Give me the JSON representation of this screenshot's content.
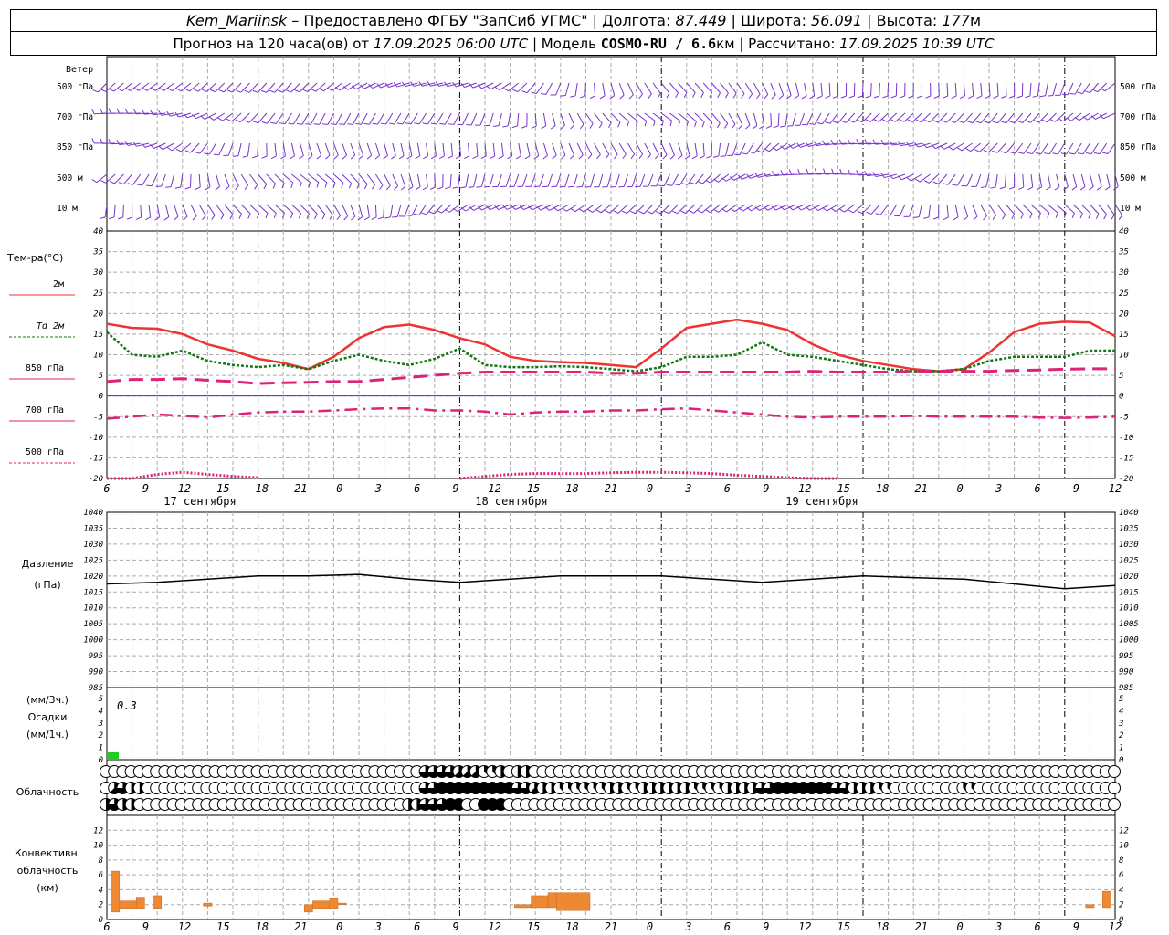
{
  "header": {
    "station": "Kem_Mariinsk",
    "dash": " – Предоставлено ФГБУ \"ЗапСиб УГМС\" | Долгота: ",
    "lon": "87.449",
    "lat_label": " | Широта: ",
    "lat": "56.091",
    "alt_label": " | Высота: ",
    "alt": "177",
    "alt_unit": "м",
    "forecast_label": "Прогноз на 120 часа(ов) от ",
    "forecast_from": "17.09.2025 06:00 UTC",
    "model_label": " | Модель ",
    "model": "COSMO-RU / 6.6",
    "model_unit": "км",
    "computed_label": " | Рассчитано: ",
    "computed": "17.09.2025 10:39 UTC"
  },
  "labels": {
    "wind_title": "Ветер",
    "wind_levels": [
      "500 гПа",
      "700 гПа",
      "850 гПа",
      "500 м",
      "10  м"
    ],
    "temp_title": "Тем-ра(°С)",
    "temp_legend": [
      "2м",
      "Td  2м",
      "850 гПа",
      "700 гПа",
      "500 гПа"
    ],
    "pressure_title": "Давление",
    "pressure_unit": "(гПа)",
    "precip_unit_top": "(мм/3ч.)",
    "precip_title": "Осадки",
    "precip_unit_bottom": "(мм/1ч.)",
    "precip_value_label": "0.3",
    "cloud_title": "Облачность",
    "conv_title": [
      "Конвективн.",
      "облачность",
      "(км)"
    ]
  },
  "colors": {
    "wind": "#7733cc",
    "t2m": "#ee3333",
    "td2m": "#117711",
    "t850": "#dd2277",
    "t700": "#dd2277",
    "t500": "#dd2277",
    "zero_line": "#3333cc",
    "pressure": "#000000",
    "precip": "#22cc22",
    "convective": "#ee8833",
    "grid": "#aaaaaa"
  },
  "chart_data": [
    {
      "type": "line",
      "title": "Тем-ра(°С)",
      "x_hours_from_start": [
        0,
        3,
        6,
        9,
        12,
        15,
        18,
        21,
        24,
        27,
        30,
        33,
        36,
        39,
        42,
        45,
        48,
        51,
        54,
        57,
        60,
        63,
        66,
        69,
        72,
        75,
        78,
        81,
        84,
        87,
        90,
        93,
        96,
        99,
        102,
        105,
        108,
        111,
        114,
        117,
        120
      ],
      "x_tick_labels": [
        "6",
        "9",
        "12",
        "15",
        "18",
        "21",
        "0",
        "3",
        "6",
        "9",
        "12",
        "15",
        "18",
        "21",
        "0",
        "3",
        "6",
        "9",
        "12",
        "15",
        "18",
        "21",
        "0",
        "3",
        "6",
        "9",
        "12"
      ],
      "date_labels": [
        "17 сентября",
        "18 сентября",
        "19 сентября"
      ],
      "ylim": [
        -20,
        40
      ],
      "yticks": [
        40,
        35,
        30,
        25,
        20,
        15,
        10,
        5,
        0,
        -5,
        -10,
        -15,
        -20
      ],
      "series": [
        {
          "name": "2м",
          "values": [
            17.5,
            16.5,
            16.3,
            15.0,
            12.5,
            11.0,
            9.0,
            8.0,
            6.5,
            9.5,
            14.0,
            16.7,
            17.3,
            16.0,
            14.0,
            12.5,
            9.5,
            8.5,
            8.2,
            8.0,
            7.5,
            7.0,
            11.5,
            16.5,
            17.5,
            18.5,
            17.5,
            16.0,
            12.5,
            10.0,
            8.5,
            7.5,
            6.5,
            6.0,
            6.5,
            10.5,
            15.5,
            17.5,
            18.0,
            17.8,
            14.5
          ]
        },
        {
          "name": "Td  2м",
          "values": [
            15.5,
            10.0,
            9.5,
            11.0,
            8.5,
            7.5,
            7.0,
            7.5,
            6.5,
            8.5,
            10.0,
            8.5,
            7.5,
            9.0,
            11.5,
            7.5,
            7.0,
            7.0,
            7.2,
            7.0,
            6.5,
            6.0,
            7.0,
            9.5,
            9.5,
            10.0,
            13.0,
            10.0,
            9.5,
            8.5,
            7.5,
            6.5,
            6.0,
            6.0,
            6.5,
            8.5,
            9.5,
            9.5,
            9.5,
            11.0,
            11.0
          ]
        },
        {
          "name": "850 гПа",
          "values": [
            3.5,
            4.0,
            4.0,
            4.2,
            3.8,
            3.5,
            3.0,
            3.2,
            3.3,
            3.5,
            3.5,
            4.0,
            4.5,
            5.0,
            5.5,
            5.8,
            5.8,
            5.8,
            5.8,
            5.8,
            5.5,
            5.5,
            5.8,
            5.8,
            5.8,
            5.8,
            5.8,
            5.8,
            6.0,
            5.8,
            5.8,
            5.8,
            6.0,
            6.0,
            6.0,
            6.0,
            6.2,
            6.3,
            6.5,
            6.6,
            6.6
          ]
        },
        {
          "name": "700 гПа",
          "values": [
            -5.5,
            -5.0,
            -4.5,
            -4.8,
            -5.2,
            -4.5,
            -4.0,
            -3.8,
            -3.8,
            -3.5,
            -3.2,
            -3.0,
            -3.0,
            -3.5,
            -3.5,
            -3.8,
            -4.5,
            -4.0,
            -3.8,
            -3.8,
            -3.5,
            -3.5,
            -3.2,
            -3.0,
            -3.5,
            -4.0,
            -4.5,
            -5.0,
            -5.2,
            -5.0,
            -5.0,
            -5.0,
            -4.8,
            -5.0,
            -5.0,
            -5.0,
            -5.0,
            -5.2,
            -5.3,
            -5.2,
            -5.0
          ]
        },
        {
          "name": "500 гПа",
          "values": [
            -22,
            -21,
            -19,
            -18.5,
            -19,
            -19.5,
            -19.8,
            null,
            null,
            null,
            null,
            null,
            null,
            null,
            -20,
            -19.5,
            -19,
            -18.8,
            -18.8,
            -18.8,
            -18.6,
            -18.5,
            -18.5,
            -18.6,
            -18.8,
            -19.2,
            -19.5,
            -19.8,
            -20,
            -20,
            null,
            null,
            null,
            null,
            null,
            null,
            null,
            null,
            null,
            null,
            null
          ]
        }
      ]
    },
    {
      "type": "line",
      "title": "Давление",
      "ylabel": "(гПа)",
      "ylim": [
        985,
        1040
      ],
      "yticks": [
        1040,
        1035,
        1030,
        1025,
        1020,
        1015,
        1010,
        1005,
        1000,
        995,
        990,
        985
      ],
      "x_hours_from_start": [
        0,
        6,
        12,
        18,
        24,
        30,
        36,
        42,
        48,
        54,
        60,
        66,
        72,
        78,
        84,
        90,
        96,
        102,
        108,
        114,
        120
      ],
      "series": [
        {
          "name": "",
          "values": [
            1017.5,
            1018,
            1019,
            1020,
            1020,
            1020.5,
            1019,
            1018,
            1019,
            1020,
            1020,
            1020,
            1019,
            1018,
            1019,
            1020,
            1019.5,
            1019,
            1017.5,
            1016,
            1017
          ]
        }
      ]
    },
    {
      "type": "bar",
      "title": "Осадки",
      "ylim": [
        0,
        5
      ],
      "yticks": [
        5,
        4,
        3,
        2,
        1,
        0
      ],
      "x_hours_from_start": [
        0
      ],
      "values": [
        0.3
      ],
      "annotation": "0.3"
    },
    {
      "type": "table",
      "title": "Облачность",
      "rows_cover_eighths": [
        [
          0,
          0,
          0,
          0,
          0,
          0,
          0,
          0,
          0,
          0,
          0,
          0,
          0,
          0,
          0,
          0,
          0,
          0,
          0,
          0,
          0,
          0,
          0,
          0,
          0,
          0,
          0,
          0,
          0,
          0,
          0,
          0,
          0,
          0,
          0,
          0,
          0,
          0,
          6,
          6,
          6,
          6,
          5,
          5,
          5,
          3,
          3,
          4,
          0,
          4,
          4,
          0,
          0,
          0,
          0,
          0,
          0,
          0,
          0,
          0,
          0,
          0,
          0,
          0,
          0,
          0,
          0,
          0,
          0,
          0,
          0,
          0,
          0,
          0,
          0,
          0,
          0,
          0,
          0,
          0,
          0,
          0,
          0,
          0,
          0,
          0,
          0,
          0,
          0,
          0,
          0,
          0,
          0,
          0,
          0,
          0,
          0,
          0,
          0,
          0,
          0,
          0,
          0,
          0,
          0,
          0,
          0,
          0,
          0,
          0,
          0,
          0,
          0,
          0,
          0,
          0,
          0,
          0,
          0,
          0,
          0
        ],
        [
          0,
          5,
          6,
          4,
          4,
          0,
          0,
          0,
          0,
          0,
          0,
          0,
          0,
          0,
          0,
          0,
          0,
          0,
          0,
          0,
          0,
          0,
          0,
          0,
          0,
          0,
          0,
          0,
          0,
          0,
          0,
          0,
          0,
          0,
          0,
          0,
          0,
          0,
          6,
          6,
          8,
          8,
          8,
          8,
          8,
          8,
          8,
          8,
          8,
          6,
          6,
          5,
          4,
          4,
          3,
          3,
          3,
          3,
          3,
          3,
          4,
          4,
          3,
          3,
          4,
          4,
          4,
          4,
          4,
          4,
          3,
          3,
          3,
          3,
          4,
          4,
          4,
          4,
          6,
          6,
          8,
          8,
          8,
          8,
          8,
          8,
          8,
          6,
          6,
          4,
          4,
          4,
          3,
          3,
          0,
          0,
          0,
          0,
          0,
          0,
          0,
          0,
          3,
          3,
          0,
          0,
          0,
          0,
          0,
          0,
          0,
          0,
          0,
          0,
          0,
          0,
          0,
          0,
          0,
          0,
          0
        ],
        [
          4,
          6,
          4,
          4,
          0,
          0,
          0,
          0,
          0,
          0,
          0,
          0,
          0,
          0,
          0,
          0,
          0,
          0,
          0,
          0,
          0,
          0,
          0,
          0,
          0,
          0,
          0,
          0,
          0,
          0,
          0,
          0,
          0,
          0,
          0,
          0,
          4,
          4,
          6,
          6,
          6,
          8,
          8,
          0,
          0,
          8,
          8,
          8,
          0,
          0,
          0,
          0,
          0,
          0,
          0,
          0,
          0,
          0,
          0,
          0,
          0,
          0,
          0,
          0,
          0,
          0,
          0,
          0,
          0,
          0,
          0,
          0,
          0,
          0,
          0,
          0,
          0,
          0,
          0,
          0,
          0,
          0,
          0,
          0,
          0,
          0,
          0,
          0,
          0,
          0,
          0,
          0,
          0,
          0,
          0,
          0,
          0,
          0,
          0,
          0,
          0,
          0,
          0,
          0,
          0,
          0,
          0,
          0,
          0,
          0,
          0,
          0,
          0,
          0,
          0,
          0,
          0,
          0,
          0,
          0,
          0
        ]
      ]
    },
    {
      "type": "bar",
      "title": "Конвективн. облачность (км)",
      "ylim": [
        0,
        14
      ],
      "yticks": [
        12,
        10,
        8,
        6,
        4,
        2,
        0
      ],
      "bars_hours_km": [
        {
          "h0": 0.5,
          "h1": 1.5,
          "base": 1.0,
          "top": 6.5
        },
        {
          "h0": 1.5,
          "h1": 3.5,
          "base": 1.5,
          "top": 2.5
        },
        {
          "h0": 3.5,
          "h1": 4.5,
          "base": 1.5,
          "top": 3.0
        },
        {
          "h0": 5.5,
          "h1": 6.5,
          "base": 1.5,
          "top": 3.2
        },
        {
          "h0": 11.5,
          "h1": 12.5,
          "base": 1.8,
          "top": 2.2
        },
        {
          "h0": 23.5,
          "h1": 24.5,
          "base": 1.0,
          "top": 2.0
        },
        {
          "h0": 24.5,
          "h1": 26.5,
          "base": 1.5,
          "top": 2.5
        },
        {
          "h0": 26.5,
          "h1": 27.5,
          "base": 1.5,
          "top": 2.8
        },
        {
          "h0": 27.5,
          "h1": 28.5,
          "base": 2.0,
          "top": 2.2
        },
        {
          "h0": 48.5,
          "h1": 50.5,
          "base": 1.6,
          "top": 2.0
        },
        {
          "h0": 50.5,
          "h1": 52.5,
          "base": 1.6,
          "top": 3.2
        },
        {
          "h0": 52.5,
          "h1": 53.5,
          "base": 1.6,
          "top": 3.6
        },
        {
          "h0": 53.5,
          "h1": 57.5,
          "base": 1.2,
          "top": 3.6
        },
        {
          "h0": 116.5,
          "h1": 117.5,
          "base": 1.6,
          "top": 2.0
        },
        {
          "h0": 118.5,
          "h1": 119.5,
          "base": 1.6,
          "top": 3.8
        }
      ]
    }
  ]
}
